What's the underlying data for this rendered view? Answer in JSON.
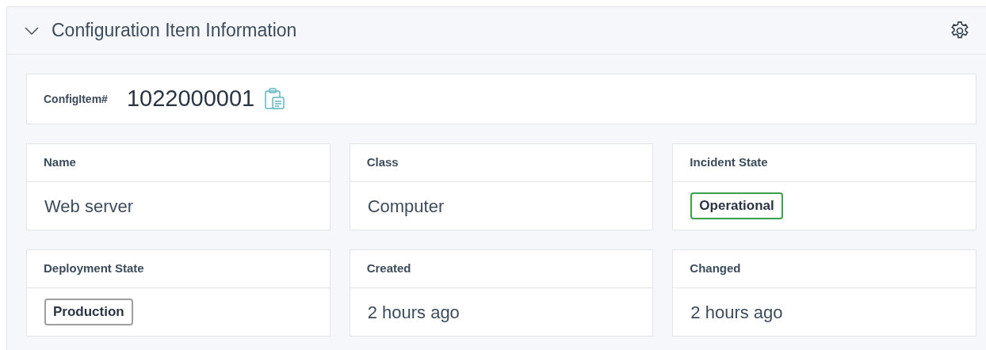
{
  "panel": {
    "title": "Configuration Item Information",
    "expanded": true
  },
  "config_item": {
    "label": "ConfigItem#",
    "number": "1022000001"
  },
  "fields": [
    {
      "label": "Name",
      "kind": "text",
      "value": "Web server"
    },
    {
      "label": "Class",
      "kind": "text",
      "value": "Computer"
    },
    {
      "label": "Incident State",
      "kind": "badge",
      "value": "Operational",
      "color": "#3aa14a"
    },
    {
      "label": "Deployment State",
      "kind": "badge",
      "value": "Production",
      "color": "#9e9e9e"
    },
    {
      "label": "Created",
      "kind": "text",
      "value": "2 hours ago"
    },
    {
      "label": "Changed",
      "kind": "text",
      "value": "2 hours ago"
    }
  ]
}
